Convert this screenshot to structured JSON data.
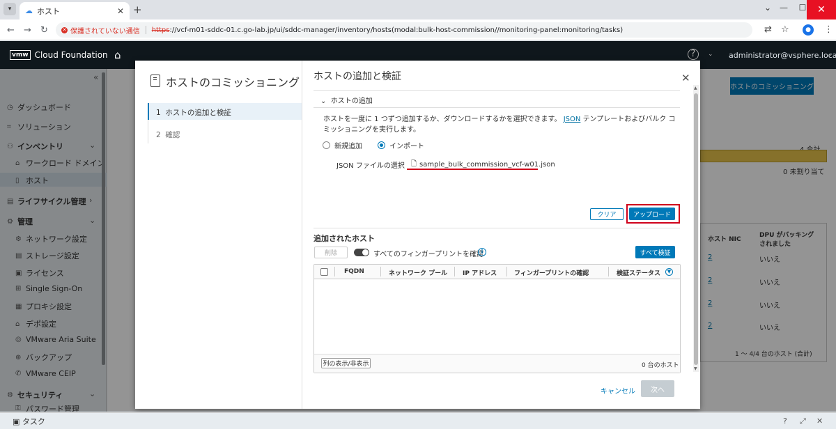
{
  "browser": {
    "tab_title": "ホスト",
    "security_label": "保護されていない通信",
    "url_scheme": "https",
    "url_rest": "://vcf-m01-sddc-01.c.go-lab.jp/ui/sddc-manager/inventory/hosts(modal:bulk-host-commission//monitoring-panel:monitoring/tasks)"
  },
  "app": {
    "brand": "vmw",
    "product": "Cloud Foundation",
    "user": "administrator@vsphere.local"
  },
  "sidebar": {
    "items": [
      {
        "label": "ダッシュボード",
        "icon": "dashboard-icon"
      },
      {
        "label": "ソリューション",
        "icon": "solutions-icon"
      },
      {
        "label": "インベントリ",
        "icon": "inventory-icon"
      },
      {
        "label": "ワークロード ドメイン",
        "icon": "domain-icon"
      },
      {
        "label": "ホスト",
        "icon": "host-icon"
      },
      {
        "label": "ライフサイクル管理",
        "icon": "lifecycle-icon"
      },
      {
        "label": "管理",
        "icon": "admin-icon"
      },
      {
        "label": "ネットワーク設定",
        "icon": "network-icon"
      },
      {
        "label": "ストレージ設定",
        "icon": "storage-icon"
      },
      {
        "label": "ライセンス",
        "icon": "license-icon"
      },
      {
        "label": "Single Sign-On",
        "icon": "sso-icon"
      },
      {
        "label": "プロキシ設定",
        "icon": "proxy-icon"
      },
      {
        "label": "デポ設定",
        "icon": "depot-icon"
      },
      {
        "label": "VMware Aria Suite",
        "icon": "aria-icon"
      },
      {
        "label": "バックアップ",
        "icon": "backup-icon"
      },
      {
        "label": "VMware CEIP",
        "icon": "ceip-icon"
      },
      {
        "label": "セキュリティ",
        "icon": "security-icon"
      },
      {
        "label": "パスワード管理",
        "icon": "password-icon"
      }
    ]
  },
  "background": {
    "commission_button": "ホストのコミッショニング",
    "total_label": "4 合計",
    "unassigned_label": "0 未割り当て",
    "col_nic": "ホスト NIC",
    "col_dpu": "DPU がバッキングされました",
    "rows": [
      {
        "nic": "2",
        "dpu": "いいえ"
      },
      {
        "nic": "2",
        "dpu": "いいえ"
      },
      {
        "nic": "2",
        "dpu": "いいえ"
      },
      {
        "nic": "2",
        "dpu": "いいえ"
      }
    ],
    "footer": "1 ～ 4/4 台のホスト (合計)"
  },
  "wizard": {
    "title": "ホストのコミッショニング",
    "steps": [
      {
        "num": "1",
        "label": "ホストの追加と検証"
      },
      {
        "num": "2",
        "label": "確認"
      }
    ],
    "page_title": "ホストの追加と検証",
    "section_title": "ホストの追加",
    "description_pre": "ホストを一度に 1 つずつ追加するか、ダウンロードするかを選択できます。",
    "description_link": "JSON",
    "description_post": "テンプレートおよびバルク コミッショニングを実行します。",
    "radio_new": "新規追加",
    "radio_import": "インポート",
    "radio_selected": "import",
    "json_label": "JSON ファイルの選択",
    "json_file": "sample_bulk_commission_vcf-w01.json",
    "clear_button": "クリア",
    "upload_button": "アップロード",
    "added_hosts_title": "追加されたホスト",
    "delete_button": "削除",
    "fingerprint_toggle": "すべてのフィンガープリントを確認",
    "verify_all_button": "すべて検証",
    "columns": [
      "FQDN",
      "ネットワーク プール",
      "IP アドレス",
      "フィンガープリントの確認",
      "検証ステータス"
    ],
    "column_toggle_button": "列の表示/非表示",
    "host_count": "0 台のホスト",
    "cancel_button": "キャンセル",
    "next_button": "次へ"
  },
  "taskbar": {
    "label": "タスク"
  }
}
